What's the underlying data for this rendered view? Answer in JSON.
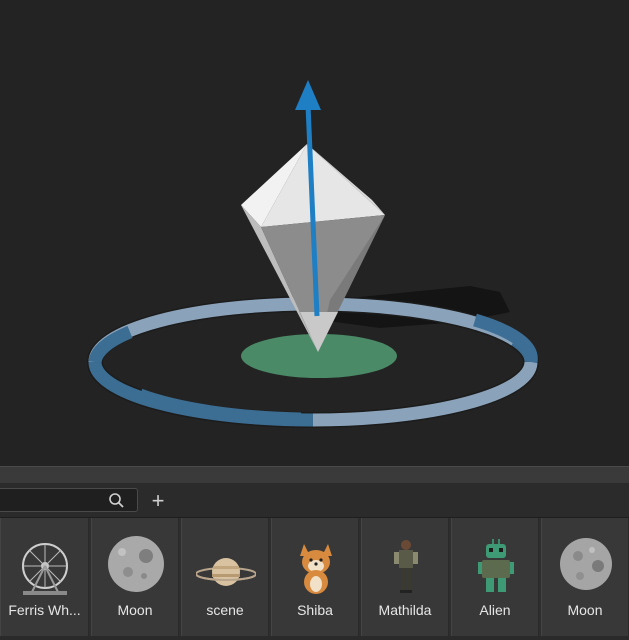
{
  "asset_browser": {
    "search": {
      "value": "",
      "placeholder": ""
    },
    "add_label": "+",
    "assets": [
      {
        "label": "Ferris Wh...",
        "icon": "ferris-wheel"
      },
      {
        "label": "Moon",
        "icon": "moon"
      },
      {
        "label": "scene",
        "icon": "saturn-planet"
      },
      {
        "label": "Shiba",
        "icon": "shiba-dog"
      },
      {
        "label": "Mathilda",
        "icon": "mathilda-figure"
      },
      {
        "label": "Alien",
        "icon": "alien-robot"
      },
      {
        "label": "Moon",
        "icon": "moon"
      }
    ]
  },
  "colors": {
    "viewport_bg": "#232323",
    "gizmo_arrow": "#1f7fc4",
    "gizmo_ring_blue": "#3c6d93",
    "gizmo_ring_gray": "#8ea6bd",
    "shadow_disc": "#4a8a66"
  }
}
